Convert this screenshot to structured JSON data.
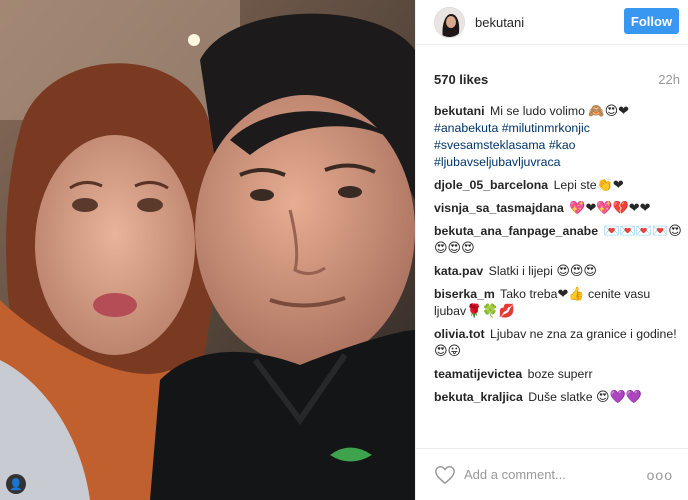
{
  "post": {
    "username": "bekutani",
    "follow_label": "Follow",
    "likes": "570 likes",
    "time": "22h"
  },
  "caption": {
    "user": "bekutani",
    "text": "Mi se ludo volimo",
    "emoji": "🙈😍❤",
    "hashtags": [
      "#anabekuta",
      "#milutinmrkonjic",
      "#svesamsteklasama",
      "#kao",
      "#ljubavseljubavljuvraca"
    ]
  },
  "comments": [
    {
      "user": "djole_05_barcelona",
      "text": "Lepi ste",
      "emoji": "👏❤"
    },
    {
      "user": "visnja_sa_tasmajdana",
      "text": "",
      "emoji": "💖❤💖💔❤❤"
    },
    {
      "user": "bekuta_ana_fanpage_anabe",
      "text": "",
      "emoji": "💌💌💌💌😍😍😍😍"
    },
    {
      "user": "kata.pav",
      "text": "Slatki i lijepi",
      "emoji": "😍😍😍"
    },
    {
      "user": "biserka_m",
      "text": "Tako treba",
      "emoji": "❤👍",
      "text2": "cenite vasu ljubav",
      "emoji2": "🌹🍀💋"
    },
    {
      "user": "olivia.tot",
      "text": "Ljubav ne zna za granice i godine!",
      "emoji": "😍😛"
    },
    {
      "user": "teamatijevictea",
      "text": "boze superr",
      "emoji": ""
    },
    {
      "user": "bekuta_kraljica",
      "text": "Duše slatke",
      "emoji": "😍💜💜"
    }
  ],
  "add_comment": {
    "placeholder": "Add a comment...",
    "more": "ooo"
  },
  "icons": {
    "like": "heart-outline-icon",
    "more": "more-options-icon",
    "tag": "user-tag-icon"
  },
  "colors": {
    "follow": "#3897f0",
    "hashtag": "#003569",
    "muted": "#999999"
  }
}
